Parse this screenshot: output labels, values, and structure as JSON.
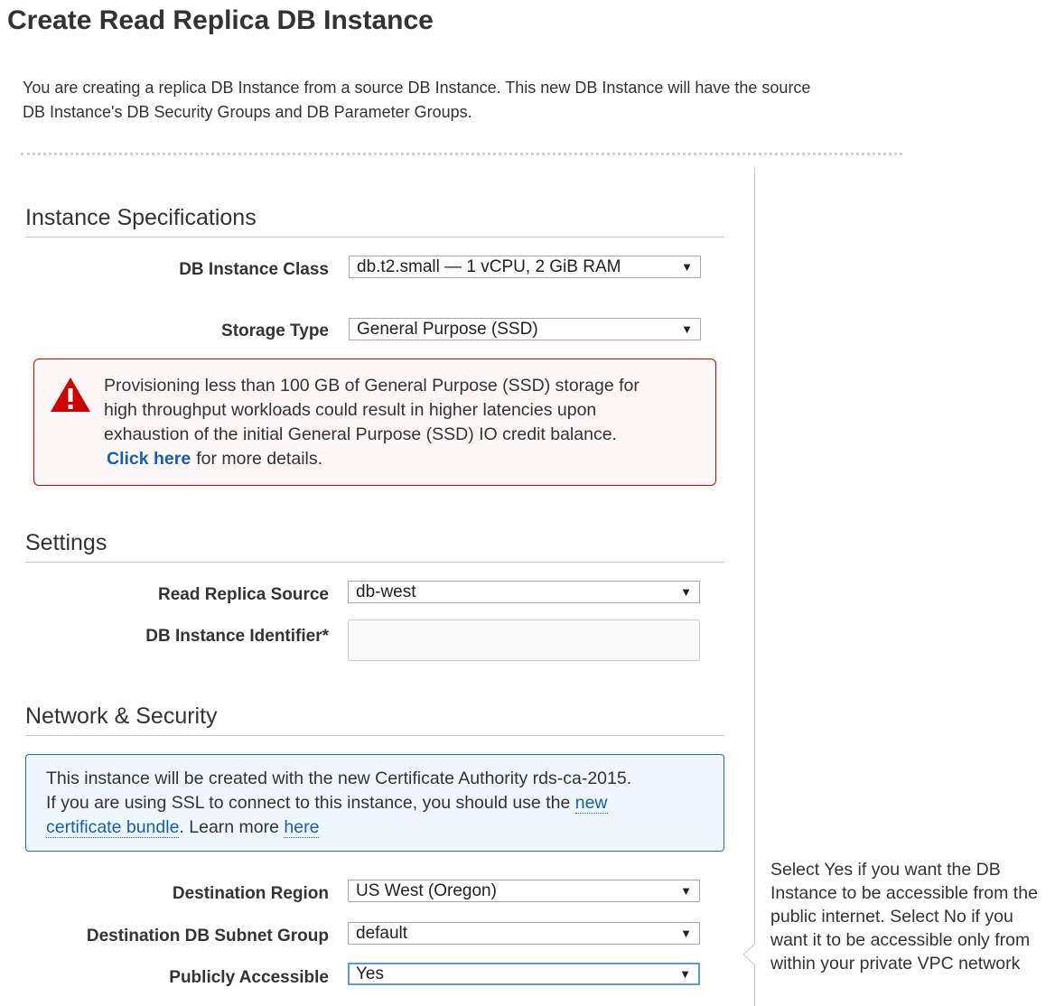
{
  "page": {
    "title": "Create Read Replica DB Instance",
    "intro_line1": "You are creating a replica DB Instance from a source DB Instance. This new DB Instance will have the source",
    "intro_line2": "DB Instance's DB Security Groups and DB Parameter Groups."
  },
  "instance_specs": {
    "heading": "Instance Specifications",
    "db_class_label": "DB Instance Class",
    "db_class_value": "db.t2.small — 1 vCPU, 2 GiB RAM",
    "storage_type_label": "Storage Type",
    "storage_type_value": "General Purpose (SSD)",
    "warning": {
      "line1": "Provisioning less than 100 GB of General Purpose (SSD) storage for",
      "line2": "high throughput workloads could result in higher latencies upon",
      "line3": "exhaustion of the initial General Purpose (SSD) IO credit balance.",
      "link": "Click here",
      "suffix": "for more details.",
      "icon": "warning-triangle-icon"
    }
  },
  "settings": {
    "heading": "Settings",
    "source_label": "Read Replica Source",
    "source_value": "db-west",
    "identifier_label": "DB Instance Identifier*",
    "identifier_value": ""
  },
  "network": {
    "heading": "Network & Security",
    "info": {
      "line1": "This instance will be created with the new Certificate Authority rds-ca-2015.",
      "line2_prefix": "If you are using SSL to connect to this instance, you should use the",
      "link1_part1": "new",
      "link1_part2": "certificate bundle",
      "learn_more": ". Learn more",
      "link2": "here"
    },
    "region_label": "Destination Region",
    "region_value": "US West (Oregon)",
    "subnet_label": "Destination DB Subnet Group",
    "subnet_value": "default",
    "public_label": "Publicly Accessible",
    "public_value": "Yes"
  },
  "help": {
    "text": "Select Yes if you want the DB Instance to be accessible from the public internet. Select No if you want it to be accessible only from within your private VPC network"
  },
  "colors": {
    "warning_border": "#cc0000",
    "warning_bg": "#fdf7f7",
    "info_border": "#2e6da4",
    "info_bg": "#eef7fc",
    "link": "#1a5fa6"
  }
}
